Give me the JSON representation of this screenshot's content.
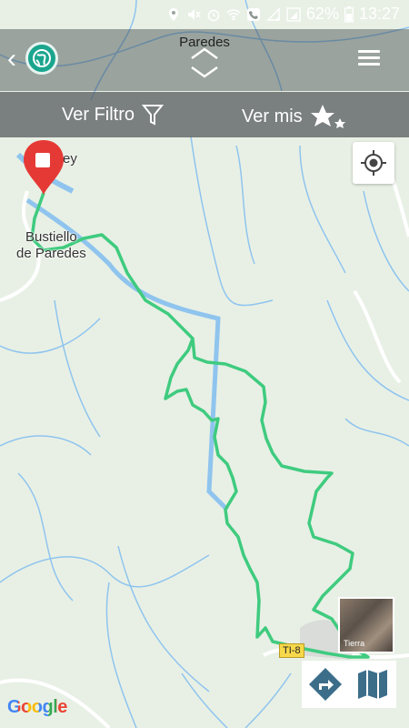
{
  "status_bar": {
    "battery": "62%",
    "time": "13:27"
  },
  "header": {
    "place_name": "Paredes",
    "back_icon": "chevron-left-icon",
    "logo_icon": "globe-icon",
    "menu_icon": "hamburger-menu-icon"
  },
  "filter_bar": {
    "filter_label": "Ver Filtro",
    "favorites_label": "Ver mis"
  },
  "map": {
    "labels": {
      "place_top": "rey",
      "place_main_1": "Bustiello",
      "place_main_2": "de Paredes"
    },
    "road_badge": "TI-8",
    "layer_label": "Tierra",
    "attribution": "Google"
  },
  "colors": {
    "route": "#3fcb7f",
    "water": "#8fc4ee",
    "accent": "#1aa58e",
    "marker": "#e53935"
  }
}
